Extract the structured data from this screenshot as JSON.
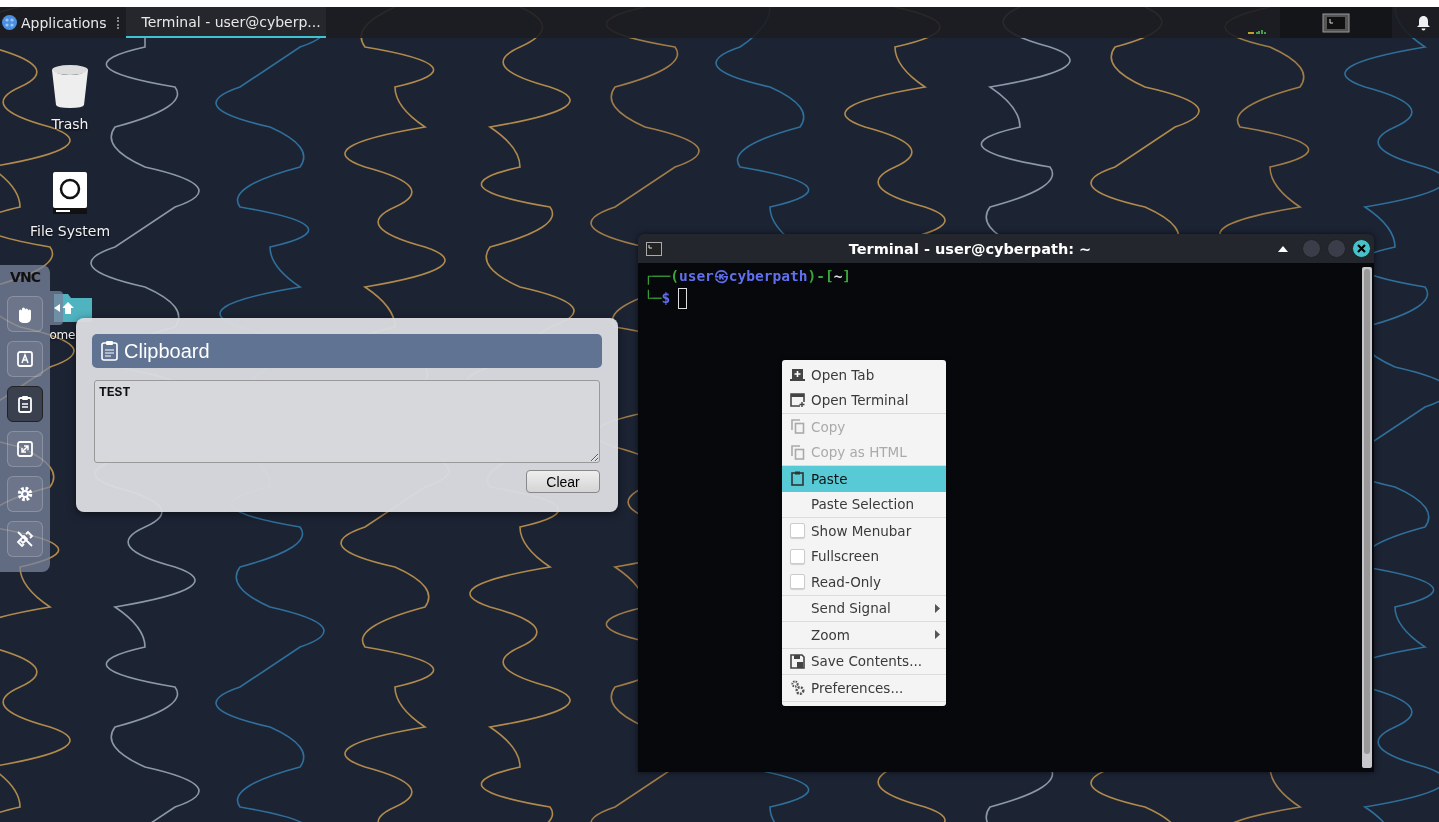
{
  "taskbar": {
    "applications_label": "Applications",
    "tasks": [
      {
        "label": "Terminal - user@cyberp...",
        "selected": true
      }
    ]
  },
  "desktop_icons": [
    {
      "label": "Trash",
      "kind": "trash"
    },
    {
      "label": "File System",
      "kind": "drive"
    },
    {
      "label": "ome",
      "kind": "folder"
    }
  ],
  "vnc_panel": {
    "title": "VNC",
    "buttons": [
      {
        "kind": "drag",
        "selected": false
      },
      {
        "kind": "keyboard",
        "selected": false
      },
      {
        "kind": "clipboard",
        "selected": true
      },
      {
        "kind": "fullscreen",
        "selected": false
      },
      {
        "kind": "settings",
        "selected": false
      },
      {
        "kind": "disconnect",
        "selected": false
      }
    ]
  },
  "clipboard": {
    "title": "Clipboard",
    "text": "TEST",
    "button": "Clear"
  },
  "terminal": {
    "title": "Terminal - user@cyberpath: ~",
    "prompt_line_1": [
      {
        "text": "┌──(",
        "color": "#3aa53a"
      },
      {
        "text": "user㉿cyberpath",
        "color": "#6170f0"
      },
      {
        "text": ")-[",
        "color": "#3aa53a"
      },
      {
        "text": "~",
        "color": "#e0e0e0"
      },
      {
        "text": "]",
        "color": "#3aa53a"
      }
    ],
    "prompt_line_2": [
      {
        "text": "└─",
        "color": "#3aa53a"
      },
      {
        "text": "$",
        "color": "#6170f0"
      }
    ]
  },
  "context_menu": {
    "groups": [
      [
        {
          "label": "Open Tab",
          "kind": "open-tab",
          "disabled": false,
          "selected": false
        },
        {
          "label": "Open Terminal",
          "kind": "open-terminal",
          "disabled": false,
          "selected": false
        }
      ],
      [
        {
          "label": "Copy",
          "kind": "copy",
          "disabled": true,
          "selected": false
        },
        {
          "label": "Copy as HTML",
          "kind": "copy",
          "disabled": true,
          "selected": false
        }
      ],
      [
        {
          "label": "Paste",
          "kind": "paste",
          "disabled": false,
          "selected": true
        },
        {
          "label": "Paste Selection",
          "kind": "plain",
          "disabled": false,
          "selected": false
        }
      ],
      [
        {
          "label": "Show Menubar",
          "kind": "check",
          "checked": false,
          "disabled": false,
          "selected": false
        },
        {
          "label": "Fullscreen",
          "kind": "check",
          "checked": false,
          "disabled": false,
          "selected": false
        },
        {
          "label": "Read-Only",
          "kind": "check",
          "checked": false,
          "disabled": false,
          "selected": false
        }
      ],
      [
        {
          "label": "Send Signal",
          "kind": "submenu",
          "disabled": false,
          "selected": false
        }
      ],
      [
        {
          "label": "Zoom",
          "kind": "submenu",
          "disabled": false,
          "selected": false
        }
      ],
      [
        {
          "label": "Save Contents...",
          "kind": "save",
          "disabled": false,
          "selected": false
        }
      ],
      [
        {
          "label": "Preferences...",
          "kind": "preferences",
          "disabled": false,
          "selected": false
        }
      ]
    ]
  }
}
